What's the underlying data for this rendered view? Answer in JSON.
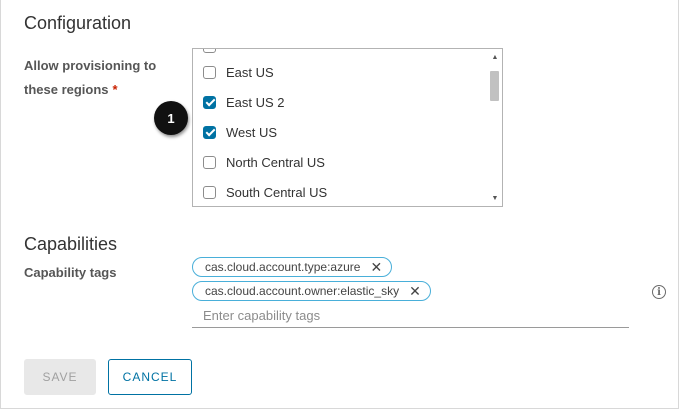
{
  "configuration": {
    "title": "Configuration",
    "regions_label_line1": "Allow provisioning to",
    "regions_label_line2": "these regions",
    "required_mark": "*",
    "regions": [
      {
        "label": "",
        "checked": false
      },
      {
        "label": "East US",
        "checked": false
      },
      {
        "label": "East US 2",
        "checked": true
      },
      {
        "label": "West US",
        "checked": true
      },
      {
        "label": "North Central US",
        "checked": false
      },
      {
        "label": "South Central US",
        "checked": false
      }
    ],
    "callout_number": "1"
  },
  "capabilities": {
    "title": "Capabilities",
    "tags_label": "Capability tags",
    "tags": [
      {
        "text": "cas.cloud.account.type:azure"
      },
      {
        "text": "cas.cloud.account.owner:elastic_sky"
      }
    ],
    "input_placeholder": "Enter capability tags",
    "info_icon": "info-icon"
  },
  "actions": {
    "save_label": "SAVE",
    "cancel_label": "CANCEL"
  },
  "colors": {
    "accent": "#0072a3",
    "tag_border": "#49afd9",
    "required": "#c92100"
  }
}
